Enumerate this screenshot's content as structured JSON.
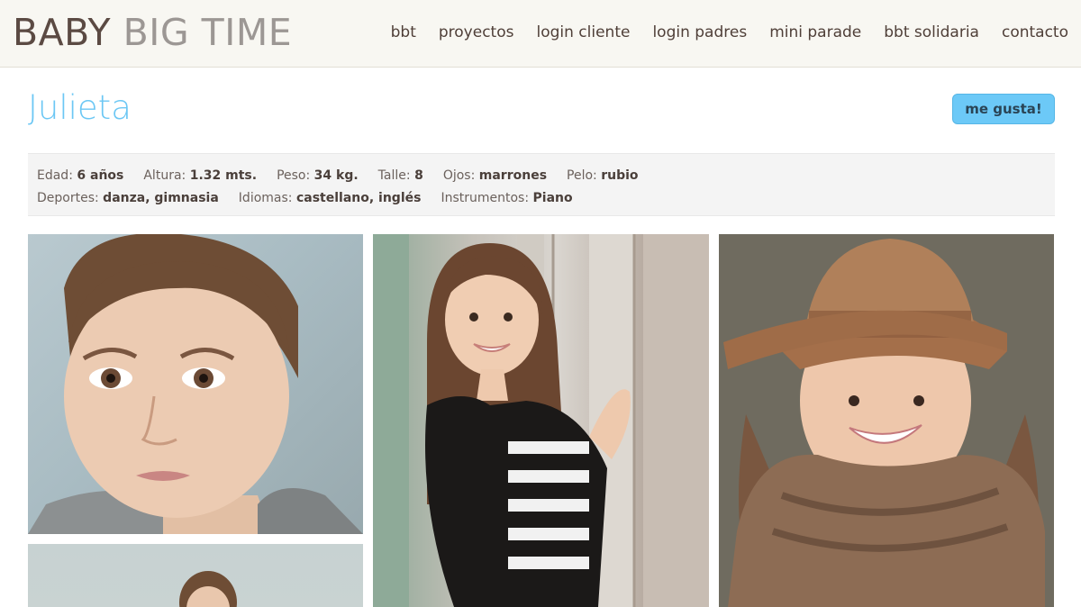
{
  "header": {
    "logo_part1": "BABY",
    "logo_part2": "BIG TIME",
    "nav": [
      "bbt",
      "proyectos",
      "login cliente",
      "login padres",
      "mini parade",
      "bbt solidaria",
      "contacto"
    ]
  },
  "profile": {
    "name": "Julieta",
    "like_label": "me gusta!",
    "row1": [
      {
        "label": "Edad:",
        "value": "6 años"
      },
      {
        "label": "Altura:",
        "value": "1.32 mts."
      },
      {
        "label": "Peso:",
        "value": "34 kg."
      },
      {
        "label": "Talle:",
        "value": "8"
      },
      {
        "label": "Ojos:",
        "value": "marrones"
      },
      {
        "label": "Pelo:",
        "value": "rubio"
      }
    ],
    "row2": [
      {
        "label": "Deportes:",
        "value": "danza, gimnasia"
      },
      {
        "label": "Idiomas:",
        "value": "castellano, inglés"
      },
      {
        "label": "Instrumentos:",
        "value": "Piano"
      }
    ]
  },
  "gallery": {
    "photos": [
      "portrait-photo-closeup",
      "portrait-photo-wooden-wall",
      "portrait-photo-hat-scarf",
      "portrait-photo-partial"
    ]
  },
  "colors": {
    "accent": "#6cc7f4",
    "topbar_bg": "#f8f7f2",
    "text_dark": "#4a3f3a"
  }
}
